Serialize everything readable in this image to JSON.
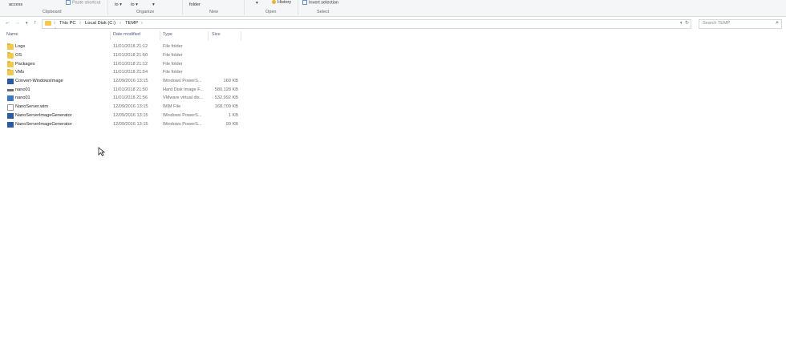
{
  "ribbon": {
    "clipboard": {
      "access_label": "access",
      "paste_shortcut_label": "Paste shortcut",
      "group_label": "Clipboard"
    },
    "organize": {
      "move_to_label": "to ▾",
      "copy_to_label": "to ▾",
      "group_label": "Organize"
    },
    "new": {
      "new_folder_label": "folder",
      "group_label": "New"
    },
    "open": {
      "history_label": "History",
      "group_label": "Open"
    },
    "select": {
      "invert_label": "Invert selection",
      "group_label": "Select"
    }
  },
  "address": {
    "crumbs": [
      "This PC",
      "Local Disk (C:)",
      "TEMP"
    ],
    "search_placeholder": "Search TEMP"
  },
  "columns": {
    "name": "Name",
    "date": "Date modified",
    "type": "Type",
    "size": "Size"
  },
  "files": [
    {
      "icon": "folder-icon",
      "name": "Logs",
      "date": "11/01/2018 21:12",
      "type": "File folder",
      "size": ""
    },
    {
      "icon": "folder-icon",
      "name": "OS",
      "date": "11/01/2018 21:50",
      "type": "File folder",
      "size": ""
    },
    {
      "icon": "folder-icon",
      "name": "Packages",
      "date": "11/01/2018 21:12",
      "type": "File folder",
      "size": ""
    },
    {
      "icon": "folder-icon",
      "name": "VMs",
      "date": "11/01/2018 21:54",
      "type": "File folder",
      "size": ""
    },
    {
      "icon": "powershell-icon",
      "name": "Convert-WindowsImage",
      "date": "12/09/2016 13:15",
      "type": "Windows PowerS...",
      "size": "160 KB"
    },
    {
      "icon": "disk-image-icon",
      "name": "nano01",
      "date": "11/01/2018 21:50",
      "type": "Hard Disk Image F...",
      "size": "580,128 KB"
    },
    {
      "icon": "vmware-icon",
      "name": "nano01",
      "date": "11/01/2018 21:56",
      "type": "VMware virtual dis...",
      "size": "532,992 KB"
    },
    {
      "icon": "file-icon",
      "name": "NanoServer.wim",
      "date": "12/09/2016 13:15",
      "type": "WIM File",
      "size": "168,709 KB"
    },
    {
      "icon": "powershell-icon",
      "name": "NanoServerImageGenerator",
      "date": "12/09/2016 13:15",
      "type": "Windows PowerS...",
      "size": "1 KB"
    },
    {
      "icon": "powershell-icon",
      "name": "NanoServerImageGenerator",
      "date": "12/09/2016 13:15",
      "type": "Windows PowerS...",
      "size": "99 KB"
    }
  ],
  "colors": {
    "folder": "#f2c94c",
    "header_text": "#4d6082",
    "ribbon_bg": "#f5f6f7"
  }
}
